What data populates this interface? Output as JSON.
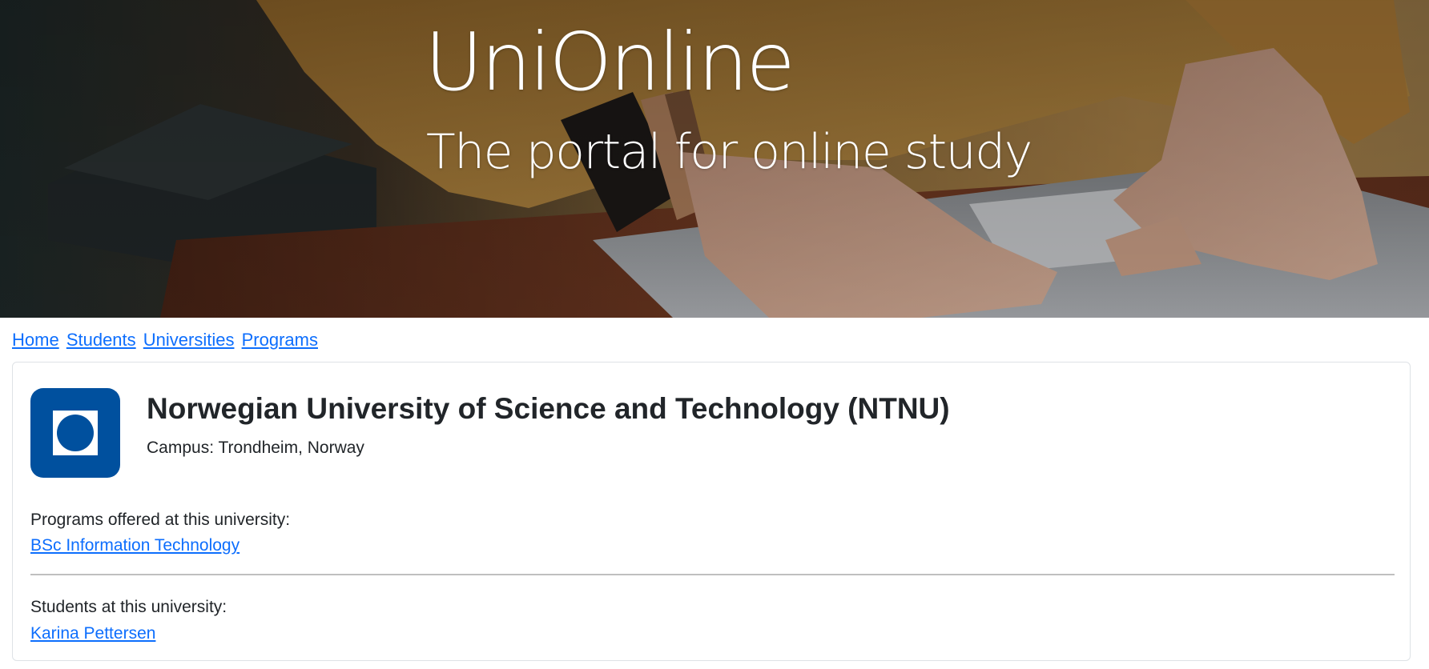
{
  "hero": {
    "title": "UniOnline",
    "subtitle": "The portal for online study"
  },
  "nav": {
    "items": [
      {
        "label": "Home"
      },
      {
        "label": "Students"
      },
      {
        "label": "Universities"
      },
      {
        "label": "Programs"
      }
    ]
  },
  "university": {
    "name": "Norwegian University of Science and Technology (NTNU)",
    "campus": "Campus: Trondheim, Norway",
    "logo_color": "#00509e",
    "programs_label": "Programs offered at this university:",
    "programs": [
      {
        "label": "BSc Information Technology"
      }
    ],
    "students_label": "Students at this university:",
    "students": [
      {
        "label": "Karina Pettersen"
      }
    ]
  },
  "colors": {
    "link": "#0d6efd",
    "text": "#212529",
    "card_border": "#dee2e6"
  }
}
